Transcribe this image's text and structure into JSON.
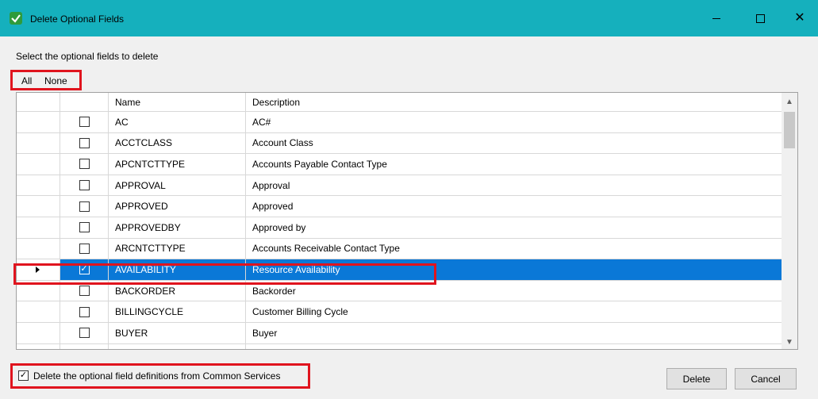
{
  "window": {
    "title": "Delete Optional Fields",
    "minimize_glyph": "—",
    "close_glyph": "✕"
  },
  "instruction": "Select the optional fields to delete",
  "selection": {
    "all_label": "All",
    "none_label": "None"
  },
  "grid": {
    "columns": {
      "name": "Name",
      "description": "Description"
    },
    "rows": [
      {
        "name": "AC",
        "description": "AC#",
        "checked": false,
        "selected": false
      },
      {
        "name": "ACCTCLASS",
        "description": "Account Class",
        "checked": false,
        "selected": false
      },
      {
        "name": "APCNTCTTYPE",
        "description": "Accounts Payable Contact Type",
        "checked": false,
        "selected": false
      },
      {
        "name": "APPROVAL",
        "description": "Approval",
        "checked": false,
        "selected": false
      },
      {
        "name": "APPROVED",
        "description": "Approved",
        "checked": false,
        "selected": false
      },
      {
        "name": "APPROVEDBY",
        "description": "Approved by",
        "checked": false,
        "selected": false
      },
      {
        "name": "ARCNTCTTYPE",
        "description": "Accounts Receivable Contact Type",
        "checked": false,
        "selected": false
      },
      {
        "name": "AVAILABILITY",
        "description": "Resource Availability",
        "checked": true,
        "selected": true
      },
      {
        "name": "BACKORDER",
        "description": "Backorder",
        "checked": false,
        "selected": false
      },
      {
        "name": "BILLINGCYCLE",
        "description": "Customer Billing Cycle",
        "checked": false,
        "selected": false
      },
      {
        "name": "BUYER",
        "description": "Buyer",
        "checked": false,
        "selected": false
      }
    ],
    "check_glyph": "✓"
  },
  "common_services": {
    "label": "Delete the optional field definitions from Common Services",
    "checked": true
  },
  "buttons": {
    "delete_label": "Delete",
    "cancel_label": "Cancel"
  },
  "colors": {
    "titlebar": "#15b0bd",
    "selection": "#0a78d7",
    "highlight": "#e0141e"
  }
}
